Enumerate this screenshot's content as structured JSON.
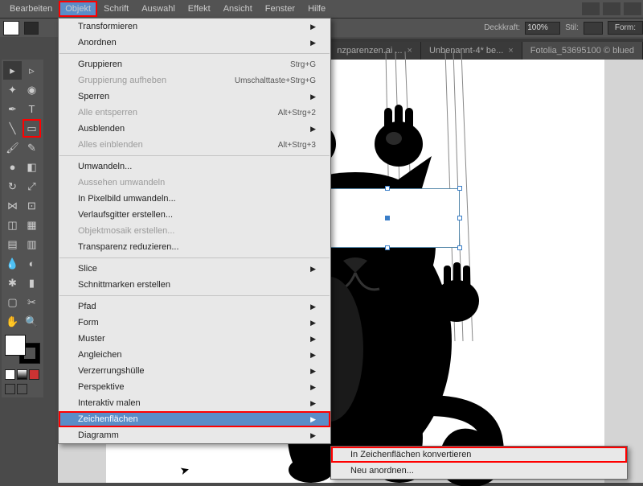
{
  "menu": {
    "items": [
      "Bearbeiten",
      "Objekt",
      "Schrift",
      "Auswahl",
      "Effekt",
      "Ansicht",
      "Fenster",
      "Hilfe"
    ],
    "active": 1
  },
  "control": {
    "opacity_label": "Deckkraft:",
    "opacity_value": "100%",
    "style_label": "Stil:",
    "form_label": "Form:"
  },
  "tabs": [
    {
      "label": "nzparenzen.ai ..."
    },
    {
      "label": "Unbenannt-4* be..."
    },
    {
      "label": "Fotolia_53695100 © blued"
    }
  ],
  "dropdown": [
    {
      "t": "Transformieren",
      "arrow": true
    },
    {
      "t": "Anordnen",
      "arrow": true
    },
    {
      "sep": true
    },
    {
      "t": "Gruppieren",
      "sc": "Strg+G"
    },
    {
      "t": "Gruppierung aufheben",
      "sc": "Umschalttaste+Strg+G",
      "dis": true
    },
    {
      "t": "Sperren",
      "arrow": true
    },
    {
      "t": "Alle entsperren",
      "sc": "Alt+Strg+2",
      "dis": true
    },
    {
      "t": "Ausblenden",
      "arrow": true
    },
    {
      "t": "Alles einblenden",
      "sc": "Alt+Strg+3",
      "dis": true
    },
    {
      "sep": true
    },
    {
      "t": "Umwandeln..."
    },
    {
      "t": "Aussehen umwandeln",
      "dis": true
    },
    {
      "t": "In Pixelbild umwandeln..."
    },
    {
      "t": "Verlaufsgitter erstellen..."
    },
    {
      "t": "Objektmosaik erstellen...",
      "dis": true
    },
    {
      "t": "Transparenz reduzieren..."
    },
    {
      "sep": true
    },
    {
      "t": "Slice",
      "arrow": true
    },
    {
      "t": "Schnittmarken erstellen"
    },
    {
      "sep": true
    },
    {
      "t": "Pfad",
      "arrow": true
    },
    {
      "t": "Form",
      "arrow": true
    },
    {
      "t": "Muster",
      "arrow": true
    },
    {
      "t": "Angleichen",
      "arrow": true
    },
    {
      "t": "Verzerrungshülle",
      "arrow": true
    },
    {
      "t": "Perspektive",
      "arrow": true
    },
    {
      "t": "Interaktiv malen",
      "arrow": true
    },
    {
      "t": "Zeichenflächen",
      "arrow": true,
      "hl": true
    },
    {
      "t": "Diagramm",
      "arrow": true
    }
  ],
  "submenu": [
    {
      "t": "In Zeichenflächen konvertieren",
      "hl": true
    },
    {
      "t": "Neu anordnen..."
    }
  ]
}
